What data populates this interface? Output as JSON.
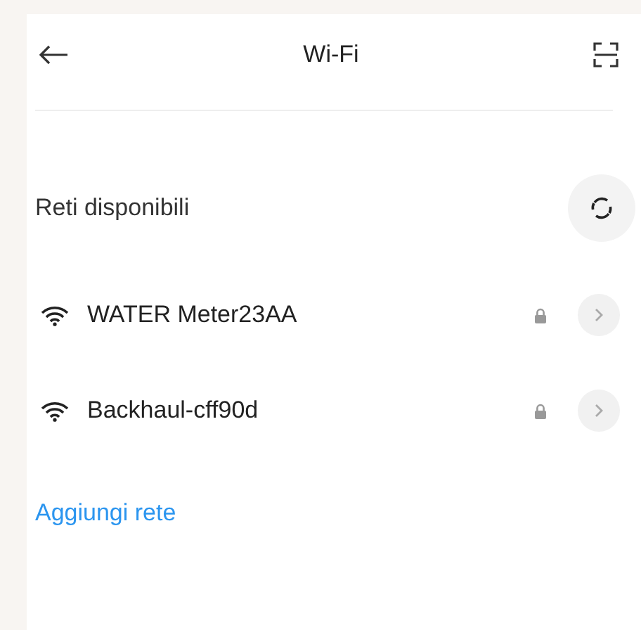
{
  "header": {
    "title": "Wi-Fi"
  },
  "section": {
    "title": "Reti disponibili"
  },
  "networks": [
    {
      "name": "WATER Meter23AA",
      "locked": true
    },
    {
      "name": "Backhaul-cff90d",
      "locked": true
    }
  ],
  "add_link": "Aggiungi rete"
}
